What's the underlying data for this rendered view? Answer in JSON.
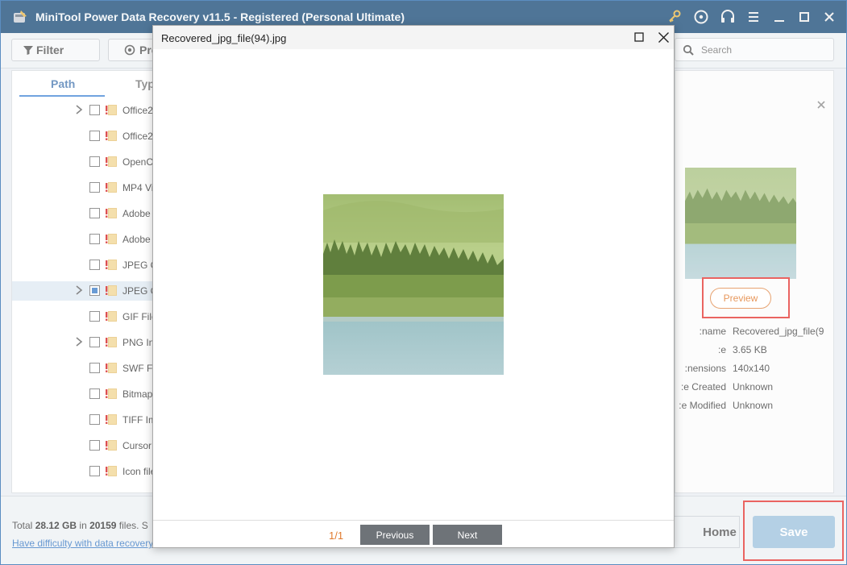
{
  "app": {
    "title": "MiniTool Power Data Recovery v11.5 - Registered (Personal Ultimate)",
    "icons": [
      "key-icon",
      "disc-icon",
      "headset-icon",
      "menu-icon",
      "minimize-icon",
      "maximize-icon",
      "close-icon"
    ]
  },
  "toolbar": {
    "filter_label": "Filter",
    "preview_label": "Pre",
    "search_placeholder": "Search"
  },
  "tabs": {
    "path": "Path",
    "type": "Typ"
  },
  "tree": [
    {
      "label": "Office2",
      "expandable": true,
      "state": "unchecked"
    },
    {
      "label": "Office2",
      "expandable": false,
      "state": "unchecked"
    },
    {
      "label": "OpenC",
      "expandable": false,
      "state": "unchecked"
    },
    {
      "label": "MP4 Vi",
      "expandable": false,
      "state": "unchecked"
    },
    {
      "label": "Adobe",
      "expandable": false,
      "state": "unchecked"
    },
    {
      "label": "Adobe",
      "expandable": false,
      "state": "unchecked"
    },
    {
      "label": "JPEG C",
      "expandable": false,
      "state": "unchecked"
    },
    {
      "label": "JPEG C",
      "expandable": true,
      "state": "partial",
      "selected": true
    },
    {
      "label": "GIF File",
      "expandable": false,
      "state": "unchecked"
    },
    {
      "label": "PNG In",
      "expandable": true,
      "state": "unchecked"
    },
    {
      "label": "SWF F",
      "expandable": false,
      "state": "unchecked"
    },
    {
      "label": "Bitmap",
      "expandable": false,
      "state": "unchecked"
    },
    {
      "label": "TIFF Im",
      "expandable": false,
      "state": "unchecked"
    },
    {
      "label": "Cursor",
      "expandable": false,
      "state": "unchecked"
    },
    {
      "label": "Icon file",
      "expandable": false,
      "state": "unchecked"
    }
  ],
  "details": {
    "preview_button": "Preview",
    "rows": [
      {
        "label": "name:",
        "value": "Recovered_jpg_file(9"
      },
      {
        "label": "e:",
        "value": "3.65 KB"
      },
      {
        "label": "nensions:",
        "value": "140x140"
      },
      {
        "label": "e Created:",
        "value": "Unknown"
      },
      {
        "label": "e Modified:",
        "value": "Unknown"
      }
    ]
  },
  "footer": {
    "total_prefix": "Total ",
    "total_size": "28.12 GB",
    "total_mid": " in ",
    "total_files": "20159",
    "total_suffix": " files.  S",
    "help_link": "Have difficulty with data recovery",
    "home_label": "Home",
    "save_label": "Save"
  },
  "modal": {
    "title": "Recovered_jpg_file(94).jpg",
    "page": "1/1",
    "previous_label": "Previous",
    "next_label": "Next"
  },
  "colors": {
    "titlebar": "#1e4f7a",
    "accent": "#4a8ad6",
    "highlight_red": "#e53935",
    "save_button": "#9fc3de",
    "page_counter": "#e07a2e"
  }
}
